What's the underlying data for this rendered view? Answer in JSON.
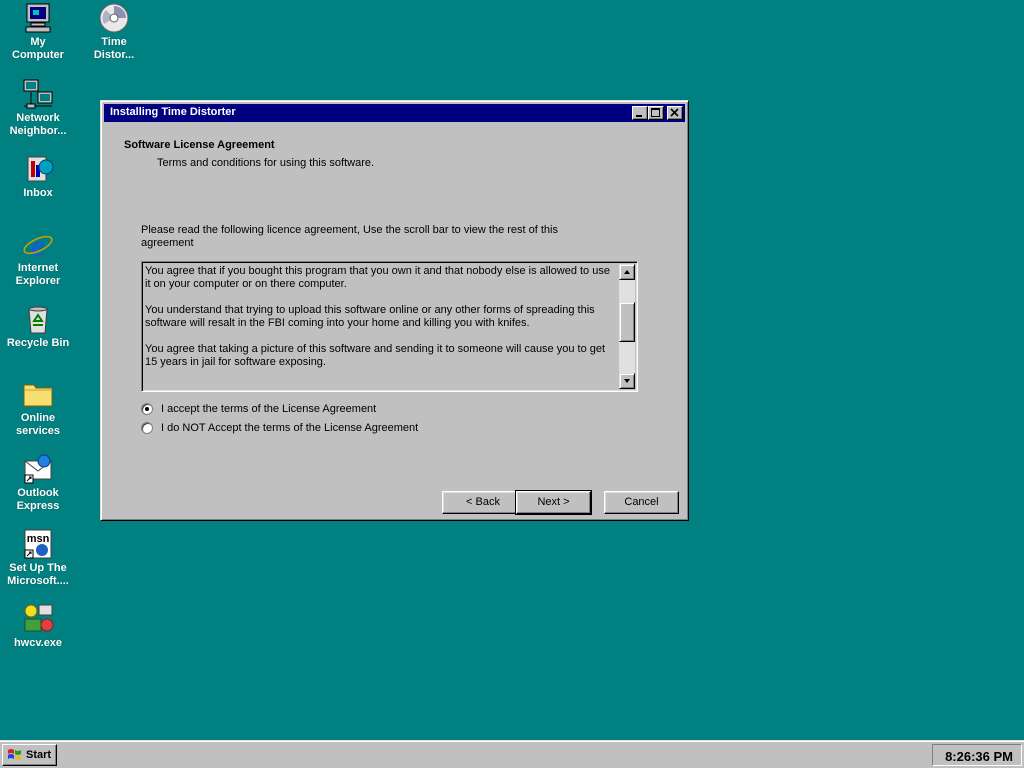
{
  "desktop": {
    "background_color": "#008080",
    "icons": [
      {
        "label": "My\nComputer",
        "icon": "my-computer-icon"
      },
      {
        "label": "Time\nDistor...",
        "icon": "time-distorter-icon"
      },
      {
        "label": "Network\nNeighbor...",
        "icon": "network-neighborhood-icon"
      },
      {
        "label": "Inbox",
        "icon": "inbox-icon"
      },
      {
        "label": "Internet\nExplorer",
        "icon": "internet-explorer-icon"
      },
      {
        "label": "Recycle Bin",
        "icon": "recycle-bin-icon"
      },
      {
        "label": "Online\nservices",
        "icon": "folder-icon"
      },
      {
        "label": "Outlook\nExpress",
        "icon": "outlook-express-icon"
      },
      {
        "label": "Set Up The\nMicrosoft....",
        "icon": "msn-setup-icon"
      },
      {
        "label": "hwcv.exe",
        "icon": "hwcv-exe-icon"
      }
    ]
  },
  "window": {
    "title": "Installing Time Distorter",
    "titlebar_color": "#000080",
    "heading": "Software License Agreement",
    "subheading": "Terms and conditions for using this software.",
    "instructions": "Please read the following licence agreement, Use the scroll bar to view the rest of this agreement",
    "license_paragraphs": [
      "You agree that if you bought this program that you own it and that nobody else is allowed to use it on your computer or on there computer.",
      "You understand that trying to upload this software online or any other forms of spreading this software will resalt in the FBI coming into your home and killing you with knifes.",
      "You agree that taking a picture of this software and sending it to someone will cause you to get 15 years in jail for software exposing."
    ],
    "options": {
      "accept": "I accept the terms of the License Agreement",
      "decline": "I do NOT Accept the terms of the License Agreement",
      "selected": "accept"
    },
    "buttons": {
      "back": "< Back",
      "next": "Next >",
      "cancel": "Cancel"
    }
  },
  "taskbar": {
    "start_label": "Start",
    "clock": "8:26:36 PM"
  }
}
